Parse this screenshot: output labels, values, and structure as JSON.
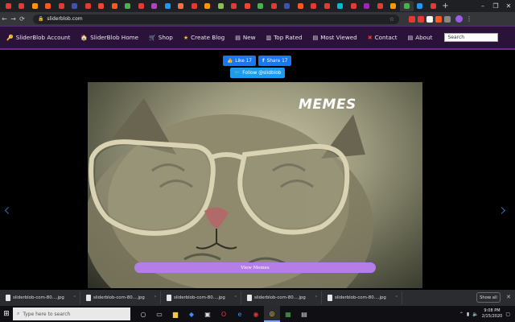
{
  "browser": {
    "tab_favicon_colors": [
      "#e53935",
      "#e53935",
      "#ff9800",
      "#ff5722",
      "#e53935",
      "#3f51b5",
      "#e53935",
      "#f44336",
      "#ff5722",
      "#4caf50",
      "#e53935",
      "#ab47bc",
      "#2196f3",
      "#ff7043",
      "#e53935",
      "#ff9800",
      "#8bc34a",
      "#e53935",
      "#f44336",
      "#4caf50",
      "#e53935",
      "#3f51b5",
      "#ff5722",
      "#e53935",
      "#e53935",
      "#00bcd4",
      "#e53935",
      "#9c27b0",
      "#e53935",
      "#ff9800",
      "#4caf50",
      "#2196f3",
      "#e53935"
    ],
    "url": "sliderblob.com",
    "window_controls": [
      "–",
      "❐",
      "✕"
    ]
  },
  "site_nav": {
    "items": [
      {
        "icon": "key-icon",
        "glyph": "🔑",
        "label": "SliderBlob Account"
      },
      {
        "icon": "home-icon",
        "glyph": "🏠",
        "label": "SliderBlob Home"
      },
      {
        "icon": "cart-icon",
        "glyph": "🛒",
        "label": "Shop"
      },
      {
        "icon": "star-icon",
        "glyph": "★",
        "label": "Create Blog"
      },
      {
        "icon": "doc-icon",
        "glyph": "▤",
        "label": "New"
      },
      {
        "icon": "chart-icon",
        "glyph": "▥",
        "label": "Top Rated"
      },
      {
        "icon": "doc-icon",
        "glyph": "▤",
        "label": "Most Viewed"
      },
      {
        "icon": "contact-icon",
        "glyph": "✖",
        "label": "Contact"
      },
      {
        "icon": "doc-icon",
        "glyph": "▤",
        "label": "About"
      }
    ],
    "search_placeholder": "Search"
  },
  "social": {
    "like_label": "Like 17",
    "share_label": "Share 17",
    "follow_label": "Follow @slidblob"
  },
  "slide": {
    "title": "MEMES",
    "button_label": "View Memes"
  },
  "downloads": {
    "items": [
      "sliderblob-com-80....jpg",
      "sliderblob-com-80....jpg",
      "sliderblob-com-80....jpg",
      "sliderblob-com-80....jpg",
      "sliderblob-com-80....jpg"
    ],
    "show_all_label": "Show all"
  },
  "taskbar": {
    "search_placeholder": "Type here to search",
    "time": "9:08 PM",
    "date": "2/15/2020"
  }
}
